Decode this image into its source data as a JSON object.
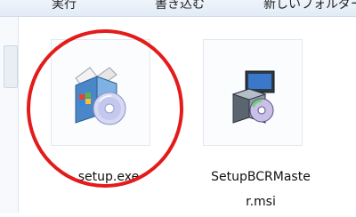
{
  "toolbar": {
    "items": [
      {
        "label": "実行"
      },
      {
        "label": "書き込む"
      },
      {
        "label": "新しいフォルダー"
      }
    ]
  },
  "files": [
    {
      "name": "setup.exe",
      "icon": "installer-box-cd-icon",
      "highlighted": true
    },
    {
      "name": "SetupBCRMaster.msi",
      "name_line1": "SetupBCRMaste",
      "name_line2": "r.msi",
      "icon": "msi-package-icon",
      "highlighted": false
    }
  ],
  "highlight_color": "#e31b1b"
}
